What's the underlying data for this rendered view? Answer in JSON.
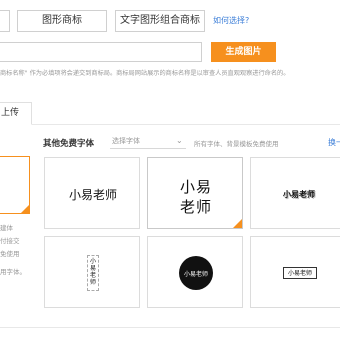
{
  "top_bar": {
    "graphic_mark": "图形商标",
    "text_graphic_mark": "文字图形组合商标",
    "help_link": "如何选择?"
  },
  "generate": {
    "name_value": "",
    "button": "生成图片"
  },
  "hint": "商标名称\" 作为必填项将会递交到商标局。商标局网站展示的商标名称是以审查人员直观观察进行命名的。",
  "tabs": {
    "upload": "上传"
  },
  "left_panel": {
    "notes": [
      "建体",
      "付接交",
      "免使用",
      "用字体。"
    ]
  },
  "fonts_section": {
    "title": "其他免费字体",
    "select_placeholder": "选择字体",
    "note": "所有字体、背景模板免费使用",
    "more": "换一"
  },
  "cards": [
    {
      "text": "小易老师"
    },
    {
      "line1": "小易",
      "line2": "老师"
    },
    {
      "text": "小易老师"
    },
    {
      "text": "小易老师"
    },
    {
      "text": "小易老师"
    },
    {
      "text": "小易老师"
    }
  ],
  "colors": {
    "accent": "#f6901e",
    "link": "#3d7fd8"
  }
}
